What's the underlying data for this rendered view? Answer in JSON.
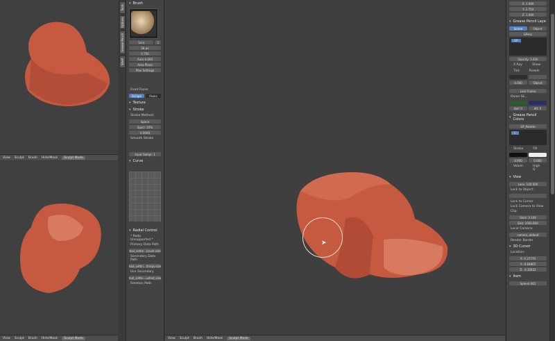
{
  "viewport_top": {
    "menu": [
      "View",
      "Sculpt",
      "Brush",
      "Hide/Mask"
    ],
    "mode": "Sculpt Mode"
  },
  "viewport_bottom": {
    "menu": [
      "View",
      "Sculpt",
      "Brush",
      "Hide/Mask"
    ],
    "mode": "Sculpt Mode"
  },
  "viewport_main": {
    "menu": [
      "View",
      "Sculpt",
      "Brush",
      "Hide/Mask"
    ],
    "mode": "Sculpt Mode"
  },
  "tool_tabs": [
    "Tools",
    "Options",
    "Grease Pencil",
    "Shelf"
  ],
  "tools": {
    "brush_header": "Brush",
    "brush_name": "Scra",
    "brush_count": "2",
    "radius": "58 px",
    "strength": "0.750",
    "autosmooth": "Auto 0.000",
    "area_plane": "Area Plane",
    "plane": "Plan Settings",
    "front_faces": "Front Faces",
    "tabs": [
      "Scrape",
      "Peaks"
    ],
    "texture_header": "Texture",
    "stroke_header": "Stroke",
    "stroke_method_label": "Stroke Method:",
    "stroke_method": "Space",
    "spacing": "Spaci: 10%",
    "jitter": "0.0000",
    "smooth_stroke": "Smooth Stroke",
    "input_samples": "Input Sampl: 1",
    "curve_header": "Curve",
    "radial_header": "Radial Control",
    "radial_note": "* Redo Unsupported *",
    "primary_label": "Primary Data Path",
    "primary_value": "tool_settin...brush.size",
    "secondary_label": "Secondary Data Path",
    "secondary_value": "tool_settin...things.size",
    "use_secondary_label": "Use Secondary",
    "use_secondary_value": "tool_settin...ushed_size",
    "rotation_label": "Rotation Path"
  },
  "props": {
    "x": "X: 1.000",
    "y": "Y: 2.750",
    "z": "Z: 1.000",
    "gp_layers_header": "Grease Pencil Laye",
    "scene_tab": "Scene",
    "object_tab": "Object",
    "gpencil_name": "GPenc",
    "gp_layer": "GP",
    "opacity": "Opacity: 1.000",
    "xray": "X Ray",
    "show": "Show",
    "tint_label": "Tint",
    "parent_label": "Parent:",
    "tint_val": "0.000",
    "parent_type": "Object",
    "lock_frame": "Lock Frame",
    "onion": "Onion Sk...",
    "before": "Bef: 0",
    "after": "Aft: 0",
    "palette_header": "Grease Pencil Colors",
    "palette_name": "GP_Palette",
    "color_name": "C",
    "stroke_label": "Stroke",
    "fill_label": "Fill",
    "stroke_val": "0.900",
    "fill_val": "0.000",
    "volum": "Volum",
    "highq": "High Q",
    "view_header": "View",
    "lens": "Lens:",
    "lens_val": "100.000",
    "lock_object": "Lock to Object:",
    "lock_cursor": "Lock to Cursor",
    "lock_camera": "Lock Camera to View",
    "clip_label": "Clip:",
    "clip_start": "Start:",
    "clip_start_val": "0.100",
    "clip_end": "End:",
    "clip_end_val": "1000.000",
    "local_camera": "Local Camera:",
    "camera_default": "camera_default",
    "render_border": "Render Border",
    "cursor_header": "3D Cursor",
    "location": "Location:",
    "cx": "X:",
    "cx_val": "0.37770",
    "cy": "Y:",
    "cy_val": "-0.84865",
    "cz": "Z:",
    "cz_val": "-0.35932",
    "item_header": "Item",
    "item_name": "Sphere.001"
  }
}
